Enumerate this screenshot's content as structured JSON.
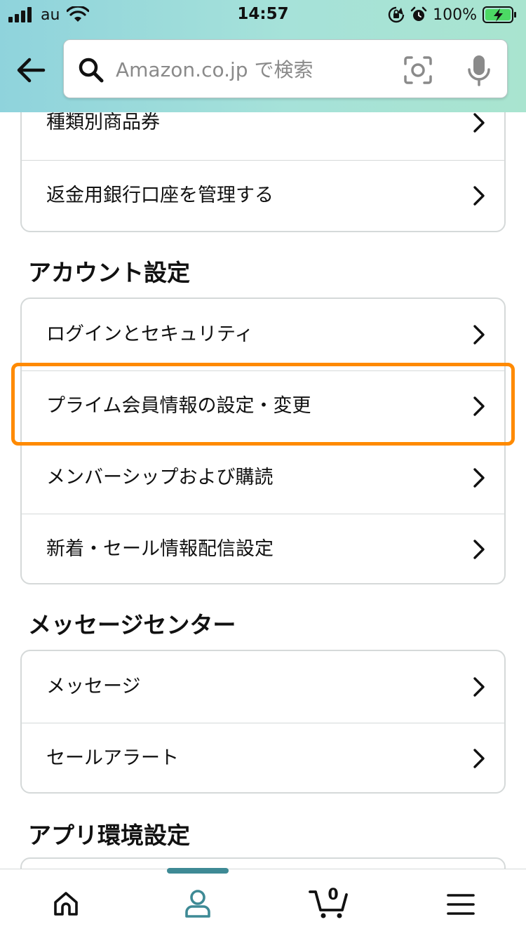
{
  "status_bar": {
    "carrier": "au",
    "time": "14:57",
    "battery": "100%"
  },
  "header": {
    "search_placeholder": "Amazon.co.jp で検索"
  },
  "top_card": {
    "items": [
      {
        "label": "種類別商品券"
      },
      {
        "label": "返金用銀行口座を管理する"
      }
    ]
  },
  "sections": [
    {
      "title": "アカウント設定",
      "items": [
        {
          "label": "ログインとセキュリティ"
        },
        {
          "label": "プライム会員情報の設定・変更"
        },
        {
          "label": "メンバーシップおよび購読"
        },
        {
          "label": "新着・セール情報配信設定"
        }
      ]
    },
    {
      "title": "メッセージセンター",
      "items": [
        {
          "label": "メッセージ"
        },
        {
          "label": "セールアラート"
        }
      ]
    },
    {
      "title": "アプリ環境設定",
      "items": []
    }
  ],
  "highlighted_item": "プライム会員情報の設定・変更",
  "tabbar": {
    "active_tab": "account",
    "cart_count": "0",
    "tabs": [
      "home-icon",
      "account-icon",
      "cart-icon",
      "menu-icon"
    ]
  },
  "colors": {
    "header_gradient_start": "#8fd3dc",
    "header_gradient_end": "#a9e4cf",
    "highlight": "#ff8a00",
    "active_tab": "#3e8a95",
    "border": "#d5d9d9"
  }
}
